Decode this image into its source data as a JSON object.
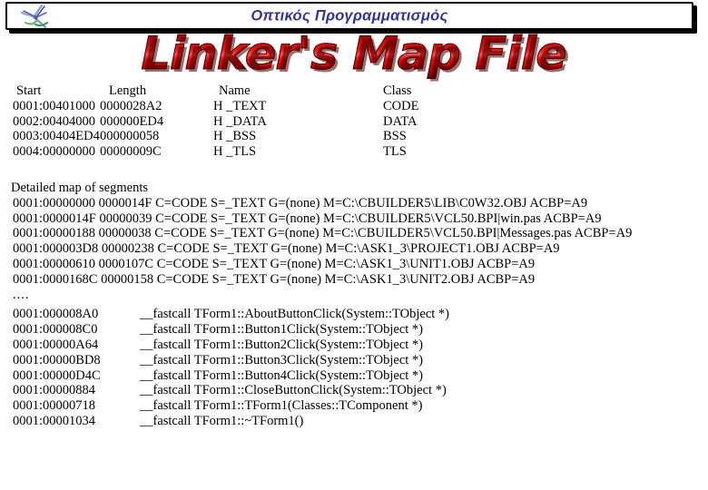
{
  "header": {
    "title": "Οπτικός Προγραμματισμός",
    "logo_icon": "starburst-logo-icon",
    "title_color": "#333399"
  },
  "wordart": {
    "text": "Linker's Map File",
    "fill_color": "#cc0000",
    "shadow_color": "#3c0000"
  },
  "segment_table": {
    "columns": [
      "Start",
      "Length",
      "Name",
      "Class"
    ],
    "rows": [
      {
        "start": "0001:00401000",
        "length": "0000028A2",
        "name": "H _TEXT",
        "class": "CODE"
      },
      {
        "start": "0002:00404000",
        "length": "000000ED4",
        "name": "H _DATA",
        "class": "DATA"
      },
      {
        "start": "0003:00404ED4",
        "length": "000000058",
        "name": "H _BSS",
        "class": "BSS"
      },
      {
        "start": "0004:00000000",
        "length": "00000009C",
        "name": "H _TLS",
        "class": "TLS"
      }
    ]
  },
  "detailed_map": {
    "heading": "Detailed map of segments",
    "lines": [
      "0001:00000000 0000014F C=CODE S=_TEXT G=(none) M=C:\\CBUILDER5\\LIB\\C0W32.OBJ ACBP=A9",
      "0001:0000014F 00000039 C=CODE S=_TEXT G=(none) M=C:\\CBUILDER5\\VCL50.BPI|win.pas ACBP=A9",
      "0001:00000188 00000038 C=CODE S=_TEXT G=(none) M=C:\\CBUILDER5\\VCL50.BPI|Messages.pas ACBP=A9",
      "0001:000003D8 00000238 C=CODE S=_TEXT G=(none) M=C:\\ASK1_3\\PROJECT1.OBJ ACBP=A9",
      "0001:00000610 0000107C C=CODE S=_TEXT G=(none) M=C:\\ASK1_3\\UNIT1.OBJ ACBP=A9",
      "0001:0000168C 00000158 C=CODE S=_TEXT G=(none) M=C:\\ASK1_3\\UNIT2.OBJ ACBP=A9"
    ],
    "ellipsis": "...."
  },
  "symbols": {
    "rows": [
      {
        "address": "0001:000008A0",
        "signature": "__fastcall TForm1::AboutButtonClick(System::TObject *)"
      },
      {
        "address": "0001:000008C0",
        "signature": "__fastcall TForm1::Button1Click(System::TObject *)"
      },
      {
        "address": "0001:00000A64",
        "signature": "__fastcall TForm1::Button2Click(System::TObject *)"
      },
      {
        "address": "0001:00000BD8",
        "signature": "__fastcall TForm1::Button3Click(System::TObject *)"
      },
      {
        "address": "0001:00000D4C",
        "signature": "__fastcall TForm1::Button4Click(System::TObject *)"
      },
      {
        "address": "0001:00000884",
        "signature": "__fastcall TForm1::CloseButtonClick(System::TObject *)"
      },
      {
        "address": "0001:00000718",
        "signature": "__fastcall TForm1::TForm1(Classes::TComponent *)"
      },
      {
        "address": "0001:00001034",
        "signature": "__fastcall TForm1::~TForm1()"
      }
    ]
  }
}
